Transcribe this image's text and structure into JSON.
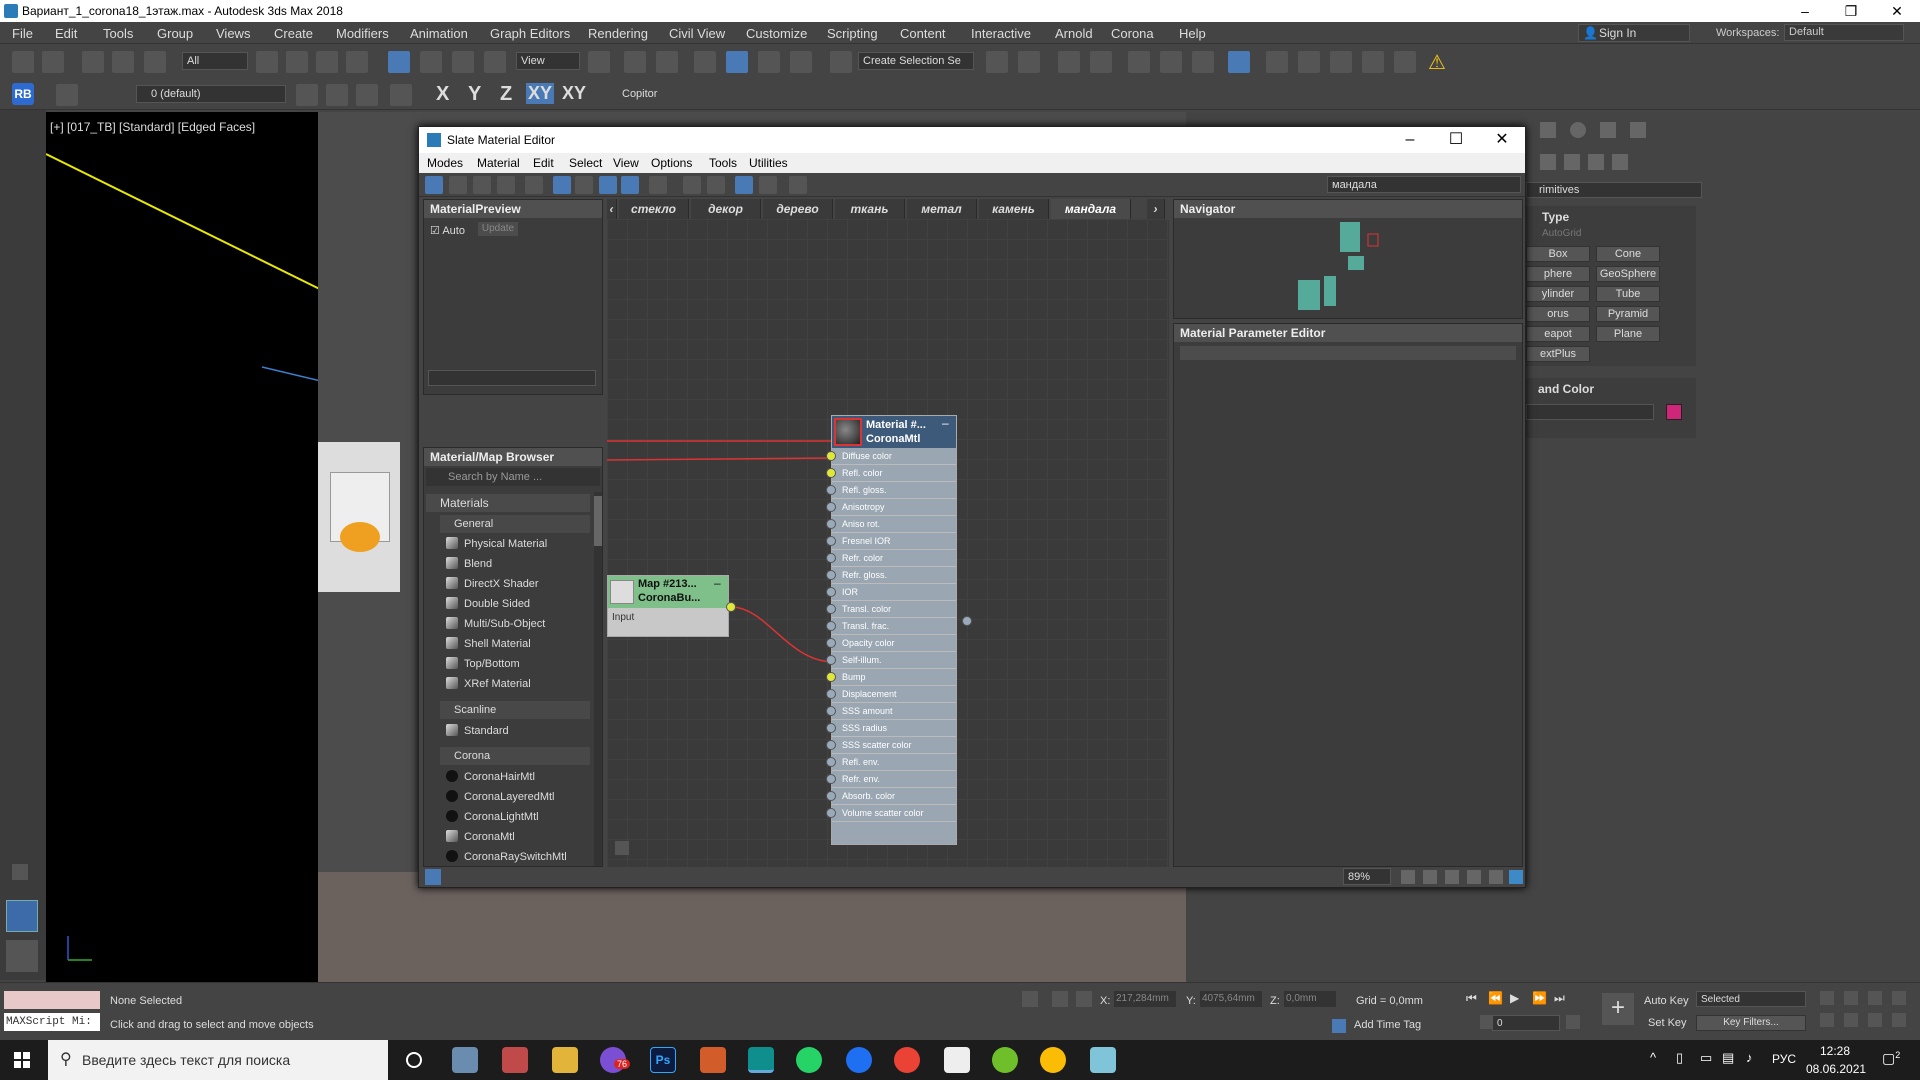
{
  "window": {
    "title": "Вариант_1_corona18_1этаж.max - Autodesk 3ds Max 2018"
  },
  "menu": [
    "File",
    "Edit",
    "Tools",
    "Group",
    "Views",
    "Create",
    "Modifiers",
    "Animation",
    "Graph Editors",
    "Rendering",
    "Civil View",
    "Customize",
    "Scripting",
    "Content",
    "Interactive",
    "Arnold",
    "Corona",
    "Help"
  ],
  "account": {
    "signin": "Sign In",
    "workspaces_label": "Workspaces:",
    "workspace": "Default"
  },
  "toolbar": {
    "filter": "All",
    "refcoord": "View",
    "selection_set": "Create Selection Se",
    "layer": "0 (default)",
    "axis_x": "X",
    "axis_y": "Y",
    "axis_z": "Z",
    "axis_xy": "XY",
    "axis_xyz": "XY",
    "copitor": "Copitor",
    "rb": "RB"
  },
  "viewport": {
    "label": "[+] [017_TB] [Standard] [Edged Faces]"
  },
  "sme": {
    "title": "Slate Material Editor",
    "menu": [
      "Modes",
      "Material",
      "Edit",
      "Select",
      "View",
      "Options",
      "Tools",
      "Utilities"
    ],
    "view_dropdown": "мандала",
    "tabs": [
      "стекло",
      "декор",
      "дерево",
      "ткань",
      "метал",
      "камень",
      "мандала"
    ],
    "preview": {
      "title": "MaterialPreview",
      "auto": "Auto",
      "update": "Update"
    },
    "browser": {
      "title": "Material/Map Browser",
      "search_placeholder": "Search by Name ...",
      "materials": "Materials",
      "general": "General",
      "general_items": [
        "Physical Material",
        "Blend",
        "DirectX Shader",
        "Double Sided",
        "Multi/Sub-Object",
        "Shell Material",
        "Top/Bottom",
        "XRef Material"
      ],
      "scanline": "Scanline",
      "scanline_items": [
        "Standard"
      ],
      "corona": "Corona",
      "corona_items": [
        "CoronaHairMtl",
        "CoronaLayeredMtl",
        "CoronaLightMtl",
        "CoronaMtl",
        "CoronaRaySwitchMtl"
      ]
    },
    "navigator": {
      "title": "Navigator"
    },
    "param_editor": {
      "title": "Material Parameter Editor"
    },
    "material_node": {
      "name": "Material #...",
      "type": "CoronaMtl",
      "slots": [
        "Diffuse color",
        "Refl. color",
        "Refl. gloss.",
        "Anisotropy",
        "Aniso rot.",
        "Fresnel IOR",
        "Refr. color",
        "Refr. gloss.",
        "IOR",
        "Transl. color",
        "Transl. frac.",
        "Opacity color",
        "Self-illum.",
        "Bump",
        "Displacement",
        "SSS amount",
        "SSS radius",
        "SSS scatter color",
        "Refl. env.",
        "Refr. env.",
        "Absorb. color",
        "Volume scatter color"
      ]
    },
    "map_node": {
      "name": "Map #213...",
      "type": "CoronaBu...",
      "slot": "Input"
    },
    "zoom": "89%"
  },
  "command_panel": {
    "category": "rimitives",
    "type_header": "Type",
    "autogrid": "AutoGrid",
    "buttons": [
      "Box",
      "Cone",
      "phere",
      "GeoSphere",
      "ylinder",
      "Tube",
      "orus",
      "Pyramid",
      "eapot",
      "Plane",
      "extPlus"
    ],
    "name_color_header": "and Color",
    "color": "#d0267a"
  },
  "status": {
    "selection": "None Selected",
    "prompt": "Click and drag to select and move objects",
    "maxscript": "MAXScript Mi:",
    "x_label": "X:",
    "x": "217,284mm",
    "y_label": "Y:",
    "y": "4075,64mm",
    "z_label": "Z:",
    "z": "0,0mm",
    "grid": "Grid = 0,0mm",
    "add_time_tag": "Add Time Tag",
    "autokey": "Auto Key",
    "setkey": "Set Key",
    "selected": "Selected",
    "keyfilters": "Key Filters...",
    "frame": "0"
  },
  "taskbar": {
    "search": "Введите здесь текст для поиска",
    "lang": "РУС",
    "time": "12:28",
    "date": "08.06.2021",
    "badge": "76",
    "notif": "2"
  }
}
